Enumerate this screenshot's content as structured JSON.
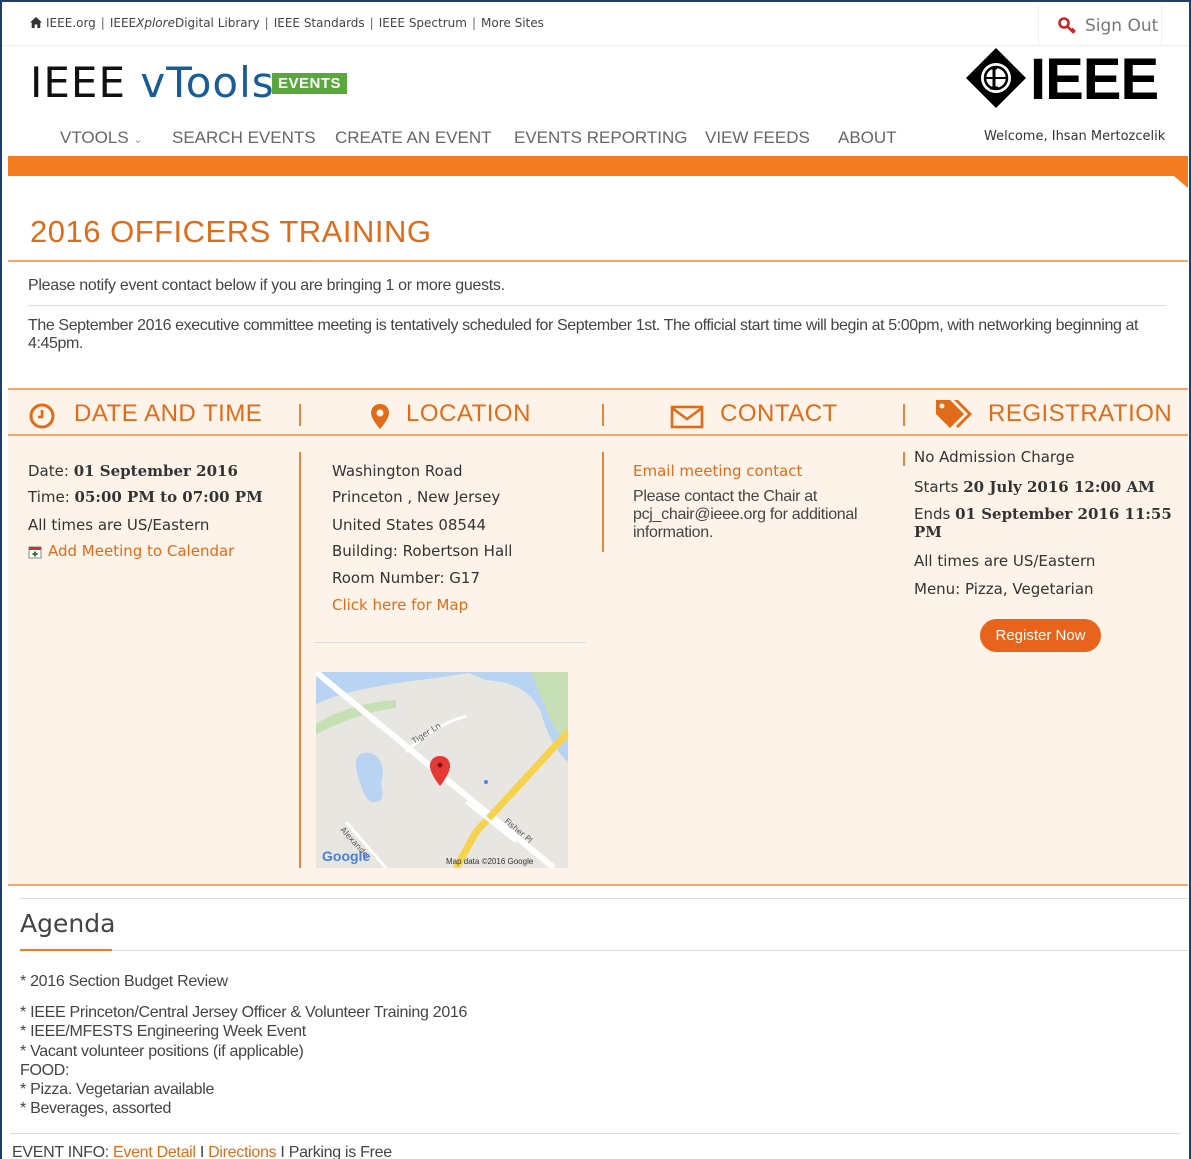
{
  "utility_bar": {
    "links": [
      {
        "label": "IEEE.org"
      },
      {
        "label": "IEEE ",
        "label_em": "Xplore",
        "label_tail": " Digital Library"
      },
      {
        "label": "IEEE Standards"
      },
      {
        "label": "IEEE Spectrum"
      },
      {
        "label": "More Sites"
      }
    ],
    "separator": "|",
    "sign_out": "Sign Out"
  },
  "header": {
    "logo_prefix": "IEEE ",
    "logo_main": "vTools",
    "badge": "EVENTS",
    "brand": "IEEE",
    "nav": [
      "VTOOLS",
      "SEARCH EVENTS",
      "CREATE AN EVENT",
      "EVENTS REPORTING",
      "VIEW FEEDS",
      "ABOUT"
    ],
    "welcome": "Welcome, Ihsan Mertozcelik"
  },
  "event": {
    "title": "2016 OFFICERS TRAINING",
    "notice": "Please notify event contact below if you are bringing 1 or more guests.",
    "description": "The September 2016 executive committee meeting is tentatively scheduled for September 1st. The official start time will begin at 5:00pm, with networking beginning at 4:45pm."
  },
  "sections": {
    "date_time": {
      "heading": "DATE AND TIME",
      "date_label": "Date: ",
      "date_value": "01 September 2016",
      "time_label": "Time: ",
      "time_value": "05:00 PM to 07:00 PM",
      "timezone": "All times are US/Eastern",
      "calendar_link": "Add Meeting to Calendar"
    },
    "location": {
      "heading": "LOCATION",
      "street": "Washington Road",
      "city_state": "Princeton , New Jersey",
      "country_zip": "United States 08544",
      "building": "Building: Robertson Hall",
      "room": "Room Number: G17",
      "map_link": "Click here for Map",
      "map_road_labels": [
        "Tiger Ln",
        "Fisher Pl",
        "Alexander"
      ],
      "map_brand": "Google",
      "map_attribution": "Map data ©2016 Google"
    },
    "contact": {
      "heading": "CONTACT",
      "email_link": "Email meeting contact",
      "text": "Please contact the Chair at pcj_chair@ieee.org for additional information."
    },
    "registration": {
      "heading": "REGISTRATION",
      "admission": "No Admission Charge",
      "starts_label": "Starts ",
      "starts_value": "20 July 2016 12:00 AM",
      "ends_label": "Ends ",
      "ends_value_line1": "01 September 2016 11:55",
      "ends_value_line2": "PM",
      "timezone": "All times are US/Eastern",
      "menu": "Menu: Pizza, Vegetarian",
      "button": "Register Now"
    }
  },
  "agenda": {
    "title": "Agenda",
    "first": "* 2016 Section Budget Review",
    "lines": [
      "* IEEE Princeton/Central Jersey Officer & Volunteer Training 2016",
      "* IEEE/MFESTS Engineering Week Event",
      "* Vacant volunteer positions (if applicable)",
      "FOOD:",
      "* Pizza.  Vegetarian available",
      "* Beverages, assorted"
    ]
  },
  "footer": {
    "label": "EVENT INFO: ",
    "detail_link": "Event Detail",
    "sep": " I ",
    "directions_link": "Directions",
    "parking": "Parking is Free"
  },
  "colors": {
    "accent": "#f47b20",
    "heading": "#e06c1a",
    "panel": "#fdf3e9",
    "badge": "#58a83b",
    "link_blue": "#1a5c96"
  }
}
